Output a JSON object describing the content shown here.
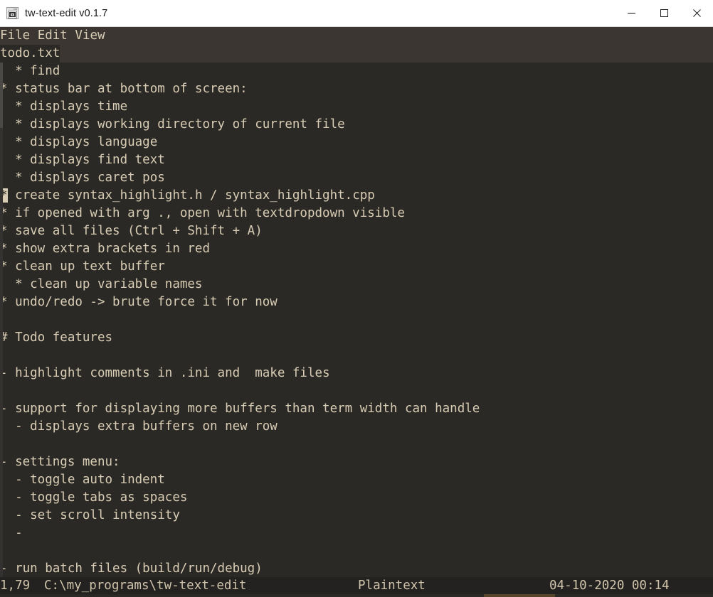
{
  "window": {
    "title": "tw-text-edit v0.1.7",
    "icon": "app-window-icon",
    "controls": {
      "minimize": "minimize-icon",
      "maximize": "maximize-icon",
      "close": "close-icon"
    }
  },
  "menubar": {
    "items": [
      {
        "label": "File"
      },
      {
        "label": "Edit"
      },
      {
        "label": "View"
      }
    ]
  },
  "tabbar": {
    "tabs": [
      {
        "label": "todo.txt",
        "active": true
      }
    ]
  },
  "editor": {
    "language": "Plaintext",
    "caret": {
      "line": 1,
      "column": 79,
      "display": "1,79"
    },
    "cursor_line_index": 7,
    "cursor_char": "*",
    "lines": [
      "  * find",
      "* status bar at bottom of screen:",
      "  * displays time",
      "  * displays working directory of current file",
      "  * displays language",
      "  * displays find text",
      "  * displays caret pos",
      "* create syntax_highlight.h / syntax_highlight.cpp",
      "* if opened with arg ., open with textdropdown visible",
      "* save all files (Ctrl + Shift + A)",
      "* show extra brackets in red",
      "* clean up text buffer",
      "  * clean up variable names",
      "* undo/redo -> brute force it for now",
      "",
      "# Todo features",
      "",
      "- highlight comments in .ini and  make files",
      "",
      "- support for displaying more buffers than term width can handle",
      "  - displays extra buffers on new row",
      "",
      "- settings menu:",
      "  - toggle auto indent",
      "  - toggle tabs as spaces",
      "  - set scroll intensity",
      "  -",
      "",
      "- run batch files (build/run/debug)"
    ]
  },
  "statusbar": {
    "position": "1,79",
    "path": "C:\\my_programs\\tw-text-edit",
    "language": "Plaintext",
    "datetime": "04-10-2020 00:14"
  },
  "colors": {
    "editor_bg": "#2b2926",
    "chrome_bg": "#3b3631",
    "status_bg": "#232220",
    "text": "#d8cdb4",
    "titlebar_bg": "#ffffff",
    "scroll_thumb": "#4b4946"
  }
}
